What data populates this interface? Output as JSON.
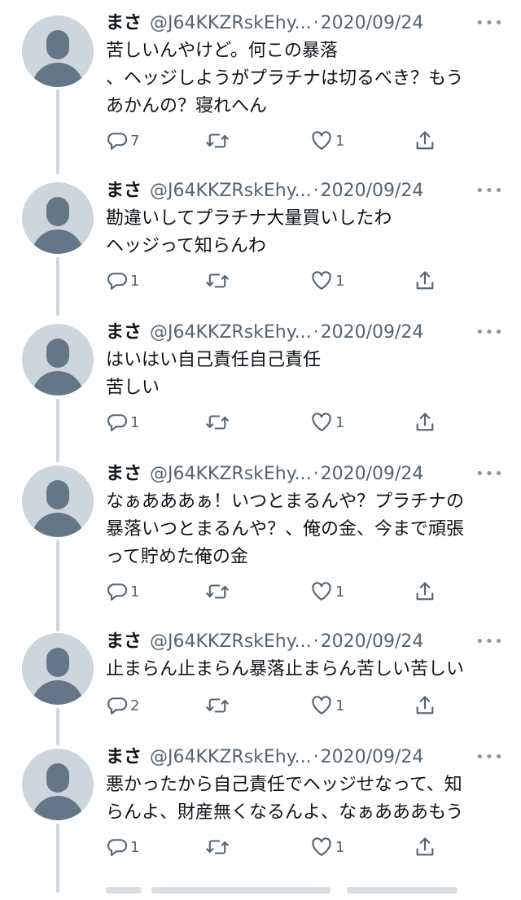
{
  "tweets": [
    {
      "name": "まさ",
      "handle": "@J64KKZRskEhy...",
      "separator": "·",
      "date": "2020/09/24",
      "more": "•••",
      "text": "苦しいんやけど。何この暴落\n、ヘッジしようがプラチナは切るべき？もう\nあかんの？寝れへん",
      "reply_count": "7",
      "retweet_count": "",
      "like_count": "1"
    },
    {
      "name": "まさ",
      "handle": "@J64KKZRskEhy...",
      "separator": "·",
      "date": "2020/09/24",
      "more": "•••",
      "text": "勘違いしてプラチナ大量買いしたわ\nヘッジって知らんわ",
      "reply_count": "1",
      "retweet_count": "",
      "like_count": "1"
    },
    {
      "name": "まさ",
      "handle": "@J64KKZRskEhy...",
      "separator": "·",
      "date": "2020/09/24",
      "more": "•••",
      "text": "はいはい自己責任自己責任\n苦しい",
      "reply_count": "1",
      "retweet_count": "",
      "like_count": "1"
    },
    {
      "name": "まさ",
      "handle": "@J64KKZRskEhy...",
      "separator": "·",
      "date": "2020/09/24",
      "more": "•••",
      "text": "なぁあああぁ！いつとまるんや？プラチナの\n暴落いつとまるんや？、俺の金、今まで頑張\nって貯めた俺の金",
      "reply_count": "1",
      "retweet_count": "",
      "like_count": "1"
    },
    {
      "name": "まさ",
      "handle": "@J64KKZRskEhy...",
      "separator": "·",
      "date": "2020/09/24",
      "more": "•••",
      "text": "止まらん止まらん暴落止まらん苦しい苦しい",
      "reply_count": "2",
      "retweet_count": "",
      "like_count": "1"
    },
    {
      "name": "まさ",
      "handle": "@J64KKZRskEhy...",
      "separator": "·",
      "date": "2020/09/24",
      "more": "•••",
      "text": "悪かったから自己責任でヘッジせなって、知\nらんよ、財産無くなるんよ、なぁあああもう",
      "reply_count": "1",
      "retweet_count": "",
      "like_count": "1"
    }
  ],
  "icons": {
    "reply": "reply-icon",
    "retweet": "retweet-icon",
    "like": "heart-icon",
    "share": "share-icon"
  },
  "colors": {
    "text_primary": "#0f1419",
    "text_secondary": "#536471",
    "avatar_bg": "#ccd6dd",
    "avatar_fg": "#657786",
    "thread_line": "#ccd6dd"
  }
}
